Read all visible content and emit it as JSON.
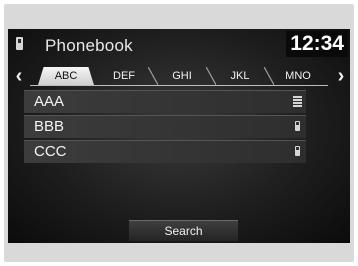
{
  "header": {
    "title": "Phonebook",
    "time": "12:34",
    "icon": "phone-icon"
  },
  "tabs": {
    "items": [
      {
        "label": "ABC",
        "active": true
      },
      {
        "label": "DEF",
        "active": false
      },
      {
        "label": "GHI",
        "active": false
      },
      {
        "label": "JKL",
        "active": false
      },
      {
        "label": "MNO",
        "active": false
      }
    ],
    "prev_icon": "chevron-left-icon",
    "next_icon": "chevron-right-icon"
  },
  "contacts": [
    {
      "name": "AAA",
      "type_icon": "office-phone-icon"
    },
    {
      "name": "BBB",
      "type_icon": "mobile-phone-icon"
    },
    {
      "name": "CCC",
      "type_icon": "mobile-phone-icon"
    }
  ],
  "search_button": {
    "label": "Search"
  },
  "colors": {
    "screen_bg": "#1e1e1e",
    "frame_bg": "#d9d9d9",
    "active_tab": "#f5f5f5",
    "text": "#f3f3f3"
  }
}
